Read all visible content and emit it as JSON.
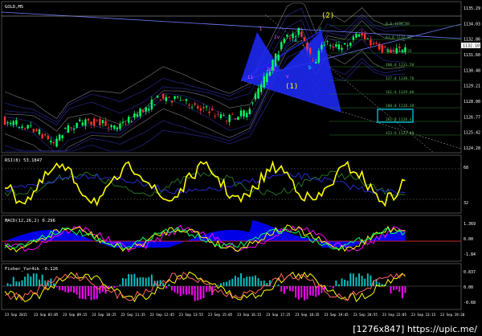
{
  "chart_data": [
    {
      "type": "candlestick",
      "title": "GOLD,M5",
      "y_axis_ticks": [
        "1135.29",
        "1134.03",
        "1132.86",
        "1131.60",
        "1130.40",
        "1129.21",
        "1128.00",
        "1126.77",
        "1125.42",
        "1124.28"
      ],
      "current_price": "1132.10",
      "wave_labels": [
        "(1)",
        "(2)",
        "i",
        "ii",
        "iii",
        "iv",
        "v",
        "a",
        "b",
        "c"
      ],
      "fib_labels": [
        "0.0 1134.08",
        "61.8 1132.81",
        "76.4 1132.25",
        "100.0 1131.50",
        "127.0 1130.78",
        "161.8 1129.60",
        "200.0 1128.38",
        "261.8 1126.41",
        "423.6 1122.88"
      ],
      "grid": false
    },
    {
      "type": "line",
      "title": "RSI(8) 53.1847",
      "y_axis_ticks": [
        "68",
        "32"
      ]
    },
    {
      "type": "line",
      "title": "MACD(12,26,2) 0.296",
      "y_axis_ticks": [
        "1.369",
        "0.00",
        "-1.84"
      ]
    },
    {
      "type": "bar",
      "title": "Fisher_Yur4ik -0.126",
      "y_axis_ticks": [
        "0.837",
        "0.00",
        "-0.68"
      ]
    }
  ],
  "time_axis": [
    "23 Sep 2015",
    "23 Sep 03:05",
    "23 Sep 09:15",
    "23 Sep 10:25",
    "23 Sep 11:35",
    "23 Sep 12:45",
    "23 Sep 13:55",
    "23 Sep 15:05",
    "23 Sep 16:15",
    "23 Sep 17:25",
    "23 Sep 18:35",
    "23 Sep 19:45",
    "23 Sep 20:55",
    "23 Sep 22:05",
    "23 Sep 23:15",
    "23 Sep 19:20"
  ],
  "watermark": "[1276x847] https://upic.me/",
  "colors": {
    "bull": "#00ff66",
    "bear": "#ff3333",
    "rsi": "#ffff00",
    "macd_fill": "#0000ff",
    "fisher_pos": "#00bfbf",
    "fisher_neg": "#ff00ff",
    "pattern": "#1f2aff",
    "box": "#00d8ff"
  }
}
